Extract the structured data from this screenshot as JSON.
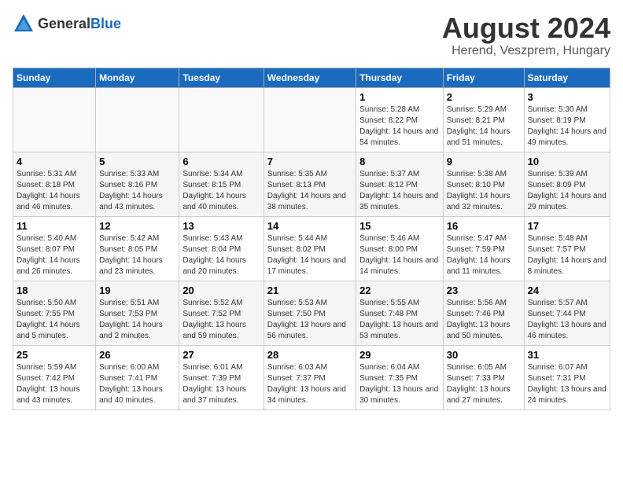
{
  "logo": {
    "general": "General",
    "blue": "Blue"
  },
  "title": "August 2024",
  "subtitle": "Herend, Veszprem, Hungary",
  "days_header": [
    "Sunday",
    "Monday",
    "Tuesday",
    "Wednesday",
    "Thursday",
    "Friday",
    "Saturday"
  ],
  "weeks": [
    [
      {
        "day": "",
        "sunrise": "",
        "sunset": "",
        "daylight": ""
      },
      {
        "day": "",
        "sunrise": "",
        "sunset": "",
        "daylight": ""
      },
      {
        "day": "",
        "sunrise": "",
        "sunset": "",
        "daylight": ""
      },
      {
        "day": "",
        "sunrise": "",
        "sunset": "",
        "daylight": ""
      },
      {
        "day": "1",
        "sunrise": "Sunrise: 5:28 AM",
        "sunset": "Sunset: 8:22 PM",
        "daylight": "Daylight: 14 hours and 54 minutes."
      },
      {
        "day": "2",
        "sunrise": "Sunrise: 5:29 AM",
        "sunset": "Sunset: 8:21 PM",
        "daylight": "Daylight: 14 hours and 51 minutes."
      },
      {
        "day": "3",
        "sunrise": "Sunrise: 5:30 AM",
        "sunset": "Sunset: 8:19 PM",
        "daylight": "Daylight: 14 hours and 49 minutes."
      }
    ],
    [
      {
        "day": "4",
        "sunrise": "Sunrise: 5:31 AM",
        "sunset": "Sunset: 8:18 PM",
        "daylight": "Daylight: 14 hours and 46 minutes."
      },
      {
        "day": "5",
        "sunrise": "Sunrise: 5:33 AM",
        "sunset": "Sunset: 8:16 PM",
        "daylight": "Daylight: 14 hours and 43 minutes."
      },
      {
        "day": "6",
        "sunrise": "Sunrise: 5:34 AM",
        "sunset": "Sunset: 8:15 PM",
        "daylight": "Daylight: 14 hours and 40 minutes."
      },
      {
        "day": "7",
        "sunrise": "Sunrise: 5:35 AM",
        "sunset": "Sunset: 8:13 PM",
        "daylight": "Daylight: 14 hours and 38 minutes."
      },
      {
        "day": "8",
        "sunrise": "Sunrise: 5:37 AM",
        "sunset": "Sunset: 8:12 PM",
        "daylight": "Daylight: 14 hours and 35 minutes."
      },
      {
        "day": "9",
        "sunrise": "Sunrise: 5:38 AM",
        "sunset": "Sunset: 8:10 PM",
        "daylight": "Daylight: 14 hours and 32 minutes."
      },
      {
        "day": "10",
        "sunrise": "Sunrise: 5:39 AM",
        "sunset": "Sunset: 8:09 PM",
        "daylight": "Daylight: 14 hours and 29 minutes."
      }
    ],
    [
      {
        "day": "11",
        "sunrise": "Sunrise: 5:40 AM",
        "sunset": "Sunset: 8:07 PM",
        "daylight": "Daylight: 14 hours and 26 minutes."
      },
      {
        "day": "12",
        "sunrise": "Sunrise: 5:42 AM",
        "sunset": "Sunset: 8:05 PM",
        "daylight": "Daylight: 14 hours and 23 minutes."
      },
      {
        "day": "13",
        "sunrise": "Sunrise: 5:43 AM",
        "sunset": "Sunset: 8:04 PM",
        "daylight": "Daylight: 14 hours and 20 minutes."
      },
      {
        "day": "14",
        "sunrise": "Sunrise: 5:44 AM",
        "sunset": "Sunset: 8:02 PM",
        "daylight": "Daylight: 14 hours and 17 minutes."
      },
      {
        "day": "15",
        "sunrise": "Sunrise: 5:46 AM",
        "sunset": "Sunset: 8:00 PM",
        "daylight": "Daylight: 14 hours and 14 minutes."
      },
      {
        "day": "16",
        "sunrise": "Sunrise: 5:47 AM",
        "sunset": "Sunset: 7:59 PM",
        "daylight": "Daylight: 14 hours and 11 minutes."
      },
      {
        "day": "17",
        "sunrise": "Sunrise: 5:48 AM",
        "sunset": "Sunset: 7:57 PM",
        "daylight": "Daylight: 14 hours and 8 minutes."
      }
    ],
    [
      {
        "day": "18",
        "sunrise": "Sunrise: 5:50 AM",
        "sunset": "Sunset: 7:55 PM",
        "daylight": "Daylight: 14 hours and 5 minutes."
      },
      {
        "day": "19",
        "sunrise": "Sunrise: 5:51 AM",
        "sunset": "Sunset: 7:53 PM",
        "daylight": "Daylight: 14 hours and 2 minutes."
      },
      {
        "day": "20",
        "sunrise": "Sunrise: 5:52 AM",
        "sunset": "Sunset: 7:52 PM",
        "daylight": "Daylight: 13 hours and 59 minutes."
      },
      {
        "day": "21",
        "sunrise": "Sunrise: 5:53 AM",
        "sunset": "Sunset: 7:50 PM",
        "daylight": "Daylight: 13 hours and 56 minutes."
      },
      {
        "day": "22",
        "sunrise": "Sunrise: 5:55 AM",
        "sunset": "Sunset: 7:48 PM",
        "daylight": "Daylight: 13 hours and 53 minutes."
      },
      {
        "day": "23",
        "sunrise": "Sunrise: 5:56 AM",
        "sunset": "Sunset: 7:46 PM",
        "daylight": "Daylight: 13 hours and 50 minutes."
      },
      {
        "day": "24",
        "sunrise": "Sunrise: 5:57 AM",
        "sunset": "Sunset: 7:44 PM",
        "daylight": "Daylight: 13 hours and 46 minutes."
      }
    ],
    [
      {
        "day": "25",
        "sunrise": "Sunrise: 5:59 AM",
        "sunset": "Sunset: 7:42 PM",
        "daylight": "Daylight: 13 hours and 43 minutes."
      },
      {
        "day": "26",
        "sunrise": "Sunrise: 6:00 AM",
        "sunset": "Sunset: 7:41 PM",
        "daylight": "Daylight: 13 hours and 40 minutes."
      },
      {
        "day": "27",
        "sunrise": "Sunrise: 6:01 AM",
        "sunset": "Sunset: 7:39 PM",
        "daylight": "Daylight: 13 hours and 37 minutes."
      },
      {
        "day": "28",
        "sunrise": "Sunrise: 6:03 AM",
        "sunset": "Sunset: 7:37 PM",
        "daylight": "Daylight: 13 hours and 34 minutes."
      },
      {
        "day": "29",
        "sunrise": "Sunrise: 6:04 AM",
        "sunset": "Sunset: 7:35 PM",
        "daylight": "Daylight: 13 hours and 30 minutes."
      },
      {
        "day": "30",
        "sunrise": "Sunrise: 6:05 AM",
        "sunset": "Sunset: 7:33 PM",
        "daylight": "Daylight: 13 hours and 27 minutes."
      },
      {
        "day": "31",
        "sunrise": "Sunrise: 6:07 AM",
        "sunset": "Sunset: 7:31 PM",
        "daylight": "Daylight: 13 hours and 24 minutes."
      }
    ]
  ]
}
